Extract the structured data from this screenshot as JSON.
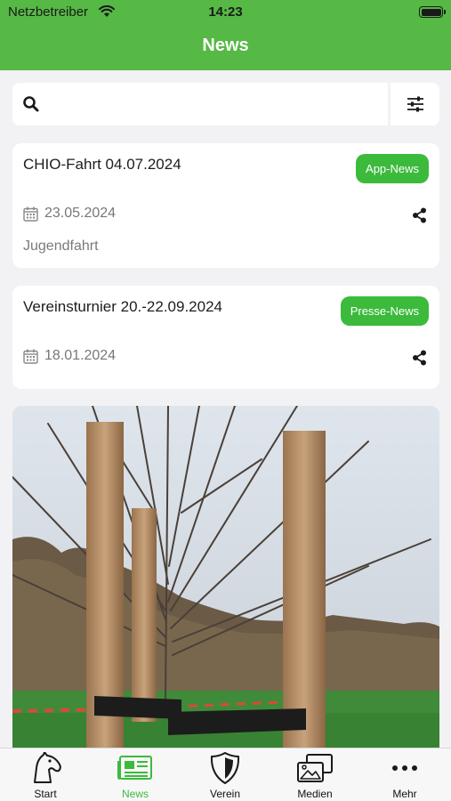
{
  "status_bar": {
    "carrier": "Netzbetreiber",
    "time": "14:23"
  },
  "header": {
    "title": "News"
  },
  "search": {
    "placeholder": ""
  },
  "news": [
    {
      "title": "CHIO-Fahrt 04.07.2024",
      "badge": "App-News",
      "date": "23.05.2024",
      "subtitle": "Jugendfahrt"
    },
    {
      "title": "Vereinsturnier 20.-22.09.2024",
      "badge": "Presse-News",
      "date": "18.01.2024"
    }
  ],
  "tabs": [
    {
      "label": "Start",
      "icon": "horse-head-icon"
    },
    {
      "label": "News",
      "icon": "newspaper-icon",
      "active": true
    },
    {
      "label": "Verein",
      "icon": "shield-icon"
    },
    {
      "label": "Medien",
      "icon": "images-icon"
    },
    {
      "label": "Mehr",
      "icon": "more-dots-icon"
    }
  ],
  "colors": {
    "header_bg": "#56b945",
    "badge_bg": "#3cba3c",
    "accent": "#3cba3c"
  }
}
